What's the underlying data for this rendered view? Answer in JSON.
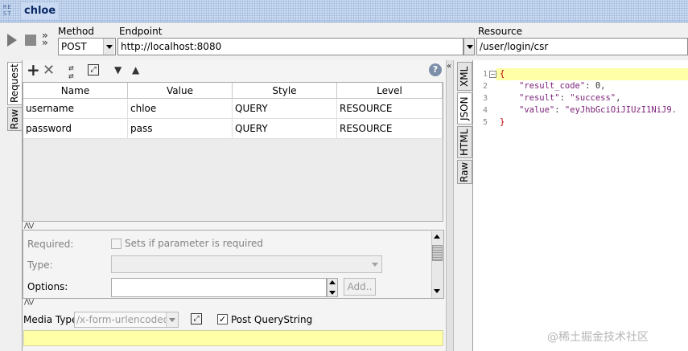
{
  "window": {
    "logo_text": "RE ST",
    "title": "chloe"
  },
  "toolbar": {
    "method_label": "Method",
    "method_value": "POST",
    "endpoint_label": "Endpoint",
    "endpoint_value": "http://localhost:8080",
    "resource_label": "Resource",
    "resource_value": "/user/login/csr"
  },
  "left_tabs": [
    "Request",
    "Raw"
  ],
  "icons": {
    "add": "plus-icon",
    "remove": "x-icon",
    "sync": "sync-icon",
    "expand": "expand-icon",
    "move_down": "chevron-down-icon",
    "move_up": "chevron-up-icon",
    "help": "help-icon"
  },
  "params_table": {
    "columns": [
      "Name",
      "Value",
      "Style",
      "Level"
    ],
    "rows": [
      [
        "username",
        "chloe",
        "QUERY",
        "RESOURCE"
      ],
      [
        "password",
        "pass",
        "QUERY",
        "RESOURCE"
      ]
    ]
  },
  "details": {
    "required_label": "Required:",
    "required_hint": "Sets if parameter is required",
    "type_label": "Type:",
    "options_label": "Options:",
    "add_button": "Add.."
  },
  "media": {
    "label": "Media Type",
    "value": "/x-form-urlencoded",
    "post_querystring_label": "Post QueryString",
    "post_querystring_checked": true
  },
  "response_tabs": [
    "XML",
    "JSON",
    "HTML",
    "Raw"
  ],
  "response": {
    "line_numbers": [
      "1",
      "2",
      "3",
      "4",
      "5"
    ],
    "lines": {
      "l1_open": "{",
      "l2_key": "\"result_code\"",
      "l2_sep": ": ",
      "l2_val": "0",
      "l2_end": ",",
      "l3_key": "\"result\"",
      "l3_sep": ": ",
      "l3_val": "\"success\"",
      "l3_end": ",",
      "l4_key": "\"value\"",
      "l4_sep": ": ",
      "l4_val": "\"eyJhbGciOiJIUzI1NiJ9.",
      "l5_close": "}"
    }
  },
  "watermark": "@稀土掘金技术社区",
  "colors": {
    "title_bar": "#c9daf2",
    "highlight": "#ffffa8",
    "json_key": "#7a1e76",
    "brace": "#c00000"
  }
}
